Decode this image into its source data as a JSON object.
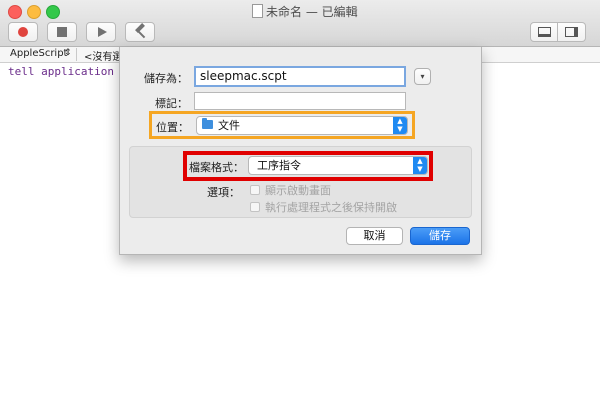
{
  "window": {
    "title": "未命名 — 已編輯"
  },
  "toolbar": {
    "record_icon": "record-icon",
    "stop_icon": "stop-icon",
    "run_icon": "play-icon",
    "compile_icon": "hammer-icon"
  },
  "langbar": {
    "language": "AppleScript",
    "element": "<沒有選"
  },
  "editor": {
    "code": "tell application \"S"
  },
  "dialog": {
    "save_as_label": "儲存為：",
    "save_as_value": "sleepmac.scpt",
    "tags_label": "標記：",
    "tags_value": "",
    "location_label": "位置：",
    "location_value": "文件",
    "format_label": "檔案格式：",
    "format_value": "工序指令",
    "options_label": "選項：",
    "option_1": "顯示啟動畫面",
    "option_2": "執行處理程式之後保持開啟",
    "cancel_label": "取消",
    "save_label": "儲存"
  },
  "colors": {
    "highlight_location": "#f5a623",
    "highlight_format": "#e00000",
    "accent": "#1f8af2"
  }
}
